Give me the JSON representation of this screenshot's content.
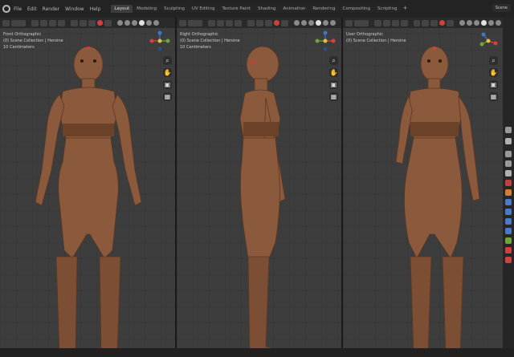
{
  "menu": {
    "items": [
      "File",
      "Edit",
      "Render",
      "Window",
      "Help"
    ]
  },
  "workspaces": {
    "tabs": [
      "Layout",
      "Modeling",
      "Sculpting",
      "UV Editing",
      "Texture Paint",
      "Shading",
      "Animation",
      "Rendering",
      "Compositing",
      "Scripting"
    ],
    "active": "Layout",
    "add": "+"
  },
  "scene": {
    "label": "Scene"
  },
  "viewports": [
    {
      "view": "Front Orthographic",
      "collection": "(0) Scene Collection | Heroine",
      "centimeters": "10 Centimeters"
    },
    {
      "view": "Right Orthographic",
      "collection": "(0) Scene Collection | Heroine",
      "centimeters": "10 Centimeters"
    },
    {
      "view": "User Orthographic",
      "collection": "(0) Scene Collection | Heroine",
      "centimeters": ""
    }
  ],
  "icons": {
    "nav": [
      "zoom-icon",
      "hand-icon",
      "camera-icon",
      "grid-icon"
    ],
    "gizmo_colors": {
      "x": "#d9403f",
      "y": "#6ea534",
      "z": "#3b78c8"
    }
  },
  "colors": {
    "viewport_bg": "#3d3d3d",
    "skin": "#8b5a3c",
    "skin_shadow": "#5c3722",
    "accent_red": "#d04040"
  }
}
